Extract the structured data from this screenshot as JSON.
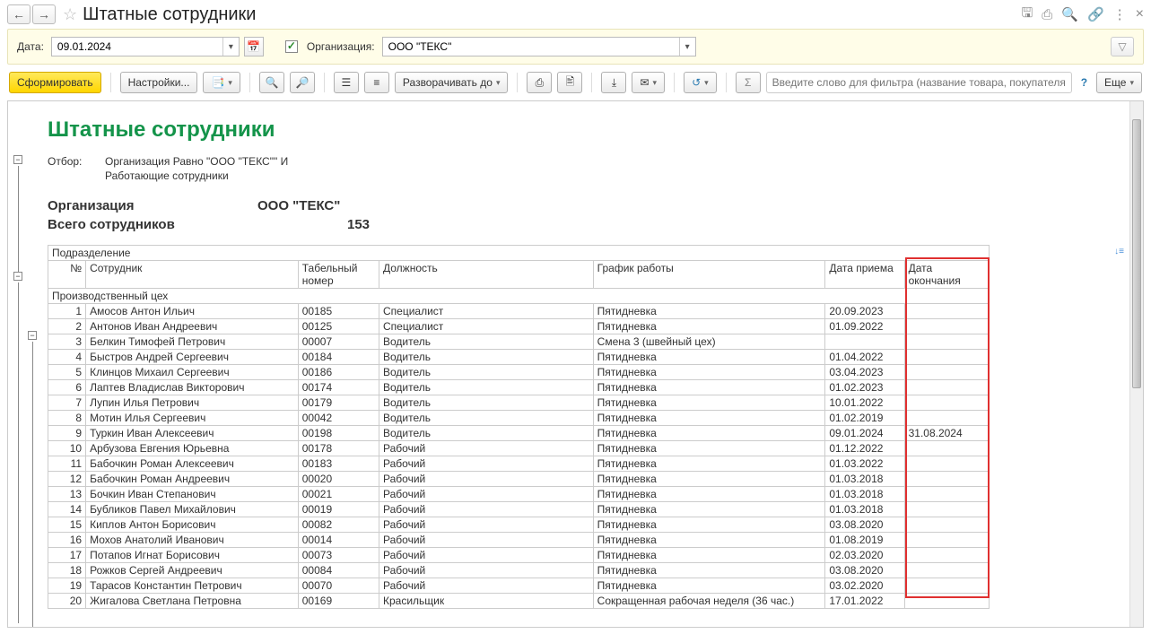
{
  "header": {
    "title": "Штатные сотрудники"
  },
  "filter": {
    "date_label": "Дата:",
    "date_value": "09.01.2024",
    "org_label": "Организация:",
    "org_value": "ООО \"ТЕКС\""
  },
  "toolbar": {
    "generate": "Сформировать",
    "settings": "Настройки...",
    "expand": "Разворачивать до",
    "more": "Еще",
    "search_placeholder": "Введите слово для фильтра (название товара, покупателя и ..."
  },
  "report": {
    "title": "Штатные сотрудники",
    "filter_label": "Отбор:",
    "filter_line1": "Организация Равно \"ООО \"ТЕКС\"\" И",
    "filter_line2": "Работающие сотрудники",
    "org_label": "Организация",
    "org_value": "ООО \"ТЕКС\"",
    "total_label": "Всего сотрудников",
    "total_value": "153",
    "group_header": "Подразделение",
    "columns": {
      "num": "№",
      "employee": "Сотрудник",
      "tabnum": "Табельный номер",
      "position": "Должность",
      "schedule": "График работы",
      "hire_date": "Дата приема",
      "end_date": "Дата окончания"
    },
    "group1_name": "Производственный цех",
    "rows": [
      {
        "n": "1",
        "emp": "Амосов Антон Ильич",
        "tab": "00185",
        "pos": "Специалист",
        "sch": "Пятидневка",
        "hire": "20.09.2023",
        "end": ""
      },
      {
        "n": "2",
        "emp": "Антонов Иван Андреевич",
        "tab": "00125",
        "pos": "Специалист",
        "sch": "Пятидневка",
        "hire": "01.09.2022",
        "end": ""
      },
      {
        "n": "3",
        "emp": "Белкин Тимофей Петрович",
        "tab": "00007",
        "pos": "Водитель",
        "sch": "Смена 3 (швейный цех)",
        "hire": "",
        "end": ""
      },
      {
        "n": "4",
        "emp": "Быстров Андрей Сергеевич",
        "tab": "00184",
        "pos": "Водитель",
        "sch": "Пятидневка",
        "hire": "01.04.2022",
        "end": ""
      },
      {
        "n": "5",
        "emp": "Клинцов Михаил Сергеевич",
        "tab": "00186",
        "pos": "Водитель",
        "sch": "Пятидневка",
        "hire": "03.04.2023",
        "end": ""
      },
      {
        "n": "6",
        "emp": "Лаптев Владислав Викторович",
        "tab": "00174",
        "pos": "Водитель",
        "sch": "Пятидневка",
        "hire": "01.02.2023",
        "end": ""
      },
      {
        "n": "7",
        "emp": "Лупин Илья Петрович",
        "tab": "00179",
        "pos": "Водитель",
        "sch": "Пятидневка",
        "hire": "10.01.2022",
        "end": ""
      },
      {
        "n": "8",
        "emp": "Мотин Илья Сергеевич",
        "tab": "00042",
        "pos": "Водитель",
        "sch": "Пятидневка",
        "hire": "01.02.2019",
        "end": ""
      },
      {
        "n": "9",
        "emp": "Туркин Иван Алексеевич",
        "tab": "00198",
        "pos": "Водитель",
        "sch": "Пятидневка",
        "hire": "09.01.2024",
        "end": "31.08.2024"
      },
      {
        "n": "10",
        "emp": "Арбузова Евгения Юрьевна",
        "tab": "00178",
        "pos": "Рабочий",
        "sch": "Пятидневка",
        "hire": "01.12.2022",
        "end": ""
      },
      {
        "n": "11",
        "emp": "Бабочкин Роман Алексеевич",
        "tab": "00183",
        "pos": "Рабочий",
        "sch": "Пятидневка",
        "hire": "01.03.2022",
        "end": ""
      },
      {
        "n": "12",
        "emp": "Бабочкин Роман Андреевич",
        "tab": "00020",
        "pos": "Рабочий",
        "sch": "Пятидневка",
        "hire": "01.03.2018",
        "end": ""
      },
      {
        "n": "13",
        "emp": "Бочкин Иван Степанович",
        "tab": "00021",
        "pos": "Рабочий",
        "sch": "Пятидневка",
        "hire": "01.03.2018",
        "end": ""
      },
      {
        "n": "14",
        "emp": "Бубликов Павел Михайлович",
        "tab": "00019",
        "pos": "Рабочий",
        "sch": "Пятидневка",
        "hire": "01.03.2018",
        "end": ""
      },
      {
        "n": "15",
        "emp": "Киплов Антон Борисович",
        "tab": "00082",
        "pos": "Рабочий",
        "sch": "Пятидневка",
        "hire": "03.08.2020",
        "end": ""
      },
      {
        "n": "16",
        "emp": "Мохов Анатолий Иванович",
        "tab": "00014",
        "pos": "Рабочий",
        "sch": "Пятидневка",
        "hire": "01.08.2019",
        "end": ""
      },
      {
        "n": "17",
        "emp": "Потапов Игнат Борисович",
        "tab": "00073",
        "pos": "Рабочий",
        "sch": "Пятидневка",
        "hire": "02.03.2020",
        "end": ""
      },
      {
        "n": "18",
        "emp": "Рожков Сергей Андреевич",
        "tab": "00084",
        "pos": "Рабочий",
        "sch": "Пятидневка",
        "hire": "03.08.2020",
        "end": ""
      },
      {
        "n": "19",
        "emp": "Тарасов Константин Петрович",
        "tab": "00070",
        "pos": "Рабочий",
        "sch": "Пятидневка",
        "hire": "03.02.2020",
        "end": ""
      },
      {
        "n": "20",
        "emp": "Жигалова Светлана Петровна",
        "tab": "00169",
        "pos": "Красильщик",
        "sch": "Сокращенная рабочая неделя (36 час.)",
        "hire": "17.01.2022",
        "end": ""
      }
    ]
  }
}
